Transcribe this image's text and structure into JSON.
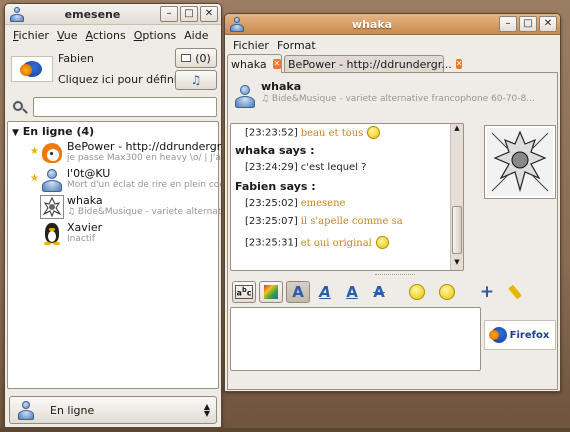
{
  "main_window": {
    "title": "emesene",
    "menu": [
      "Fichier",
      "Vue",
      "Actions",
      "Options",
      "Aide"
    ],
    "menu_accels": [
      "F",
      "V",
      "A",
      "O",
      "i"
    ],
    "user_name": "Fabien",
    "user_message": "Cliquez ici pour défini...",
    "mail_count": "(0)",
    "search_placeholder": "",
    "group_label": "En ligne (4)",
    "contacts": [
      {
        "name": "BePower - http://ddrunderground.",
        "status": "je passe Max300 en heavy \\o/ | J'ai e",
        "starred": true,
        "avatar": "bepower-avatar-icon"
      },
      {
        "name": "l'0t@KU",
        "status": "Mort d'un éclat de rire en plein coeu",
        "starred": true,
        "avatar": "person-icon"
      },
      {
        "name": "whaka",
        "status": "♫ Bide&Musique - variete alternative",
        "starred": false,
        "avatar": "sketch-avatar-icon"
      },
      {
        "name": "Xavier",
        "status": "Inactif",
        "starred": false,
        "avatar": "tux-icon"
      }
    ],
    "status_selector": "En ligne"
  },
  "chat_window": {
    "title": "whaka",
    "menu": [
      "Fichier",
      "Format"
    ],
    "tabs": [
      {
        "label": "whaka",
        "active": true
      },
      {
        "label": "BePower - http://ddrundergr...",
        "active": false
      }
    ],
    "contact_name": "whaka",
    "contact_status": "♫ Bide&Musique - variete alternative francophone 60-70-8...",
    "conversation": [
      {
        "type": "msg",
        "time": "[23:23:52]",
        "text": "beau et tous",
        "smiley": true
      },
      {
        "type": "header",
        "text": "whaka  says :"
      },
      {
        "type": "msg",
        "time": "[23:24:29]",
        "text": "c'est lequel ?",
        "smiley": false
      },
      {
        "type": "header",
        "text": "Fabien says :"
      },
      {
        "type": "msg",
        "time": "[23:25:02]",
        "text": "emesene",
        "smiley": false
      },
      {
        "type": "msg",
        "time": "[23:25:07]",
        "text": "il s'apelle comme sa",
        "smiley": false
      },
      {
        "type": "msg",
        "time": "[23:25:31]",
        "text": "et oui original",
        "smiley": true
      }
    ],
    "input_value": "",
    "firefox_badge": "Firefox"
  },
  "colors": {
    "accent_orange": "#c6861e",
    "tab_close": "#e8782a",
    "firefox_blue": "#1f3f8a"
  }
}
